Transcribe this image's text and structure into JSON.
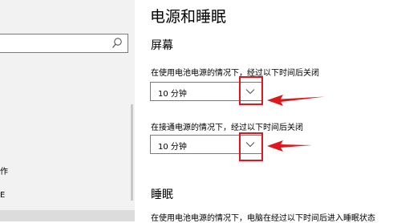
{
  "sidebar": {
    "search": {
      "placeholder": ""
    },
    "items": [
      {
        "label": "作"
      },
      {
        "label": "E"
      }
    ]
  },
  "main": {
    "page_title": "电源和睡眠",
    "screen_section": {
      "title": "屏幕",
      "battery_label": "在使用电池电源的情况下，经过以下时间后关闭",
      "battery_value": "10 分钟",
      "plugged_label": "在接通电源的情况下，经过以下时间后关闭",
      "plugged_value": "10 分钟"
    },
    "sleep_section": {
      "title": "睡眠",
      "battery_label": "在使用电池电源的情况下，电脑在经过以下时间后进入睡眠状态"
    }
  },
  "icons": {
    "search": "search-icon",
    "dropdown": "chevron-down-icon"
  },
  "colors": {
    "annotation": "#e0161d",
    "sidebar_bg": "#f2f2f2",
    "border": "#7a7a7a"
  }
}
